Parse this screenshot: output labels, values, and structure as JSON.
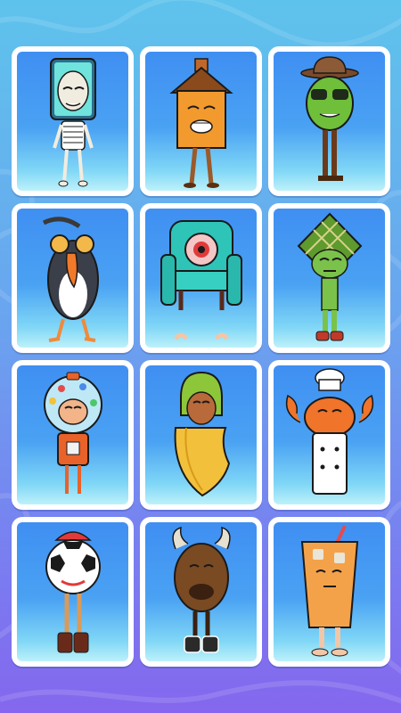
{
  "colors": {
    "background_top": "#5ec3ec",
    "background_bottom": "#8467ee",
    "card_frame": "#ffffff",
    "card_bg_top": "#3f8ff2",
    "card_bg_bottom": "#bdf1fa"
  },
  "characters": [
    {
      "id": "tablet-skeleton",
      "icon": "tablet-skeleton-icon"
    },
    {
      "id": "birdhouse",
      "icon": "birdhouse-icon"
    },
    {
      "id": "cowboy-pickle",
      "icon": "cowboy-pickle-icon"
    },
    {
      "id": "toucan-glasses",
      "icon": "toucan-icon"
    },
    {
      "id": "armchair-eye",
      "icon": "armchair-eye-icon"
    },
    {
      "id": "ketupat-man",
      "icon": "ketupat-icon"
    },
    {
      "id": "gumball-machine",
      "icon": "gumball-machine-icon"
    },
    {
      "id": "banana-monkey",
      "icon": "banana-monkey-icon"
    },
    {
      "id": "crab-chef",
      "icon": "crab-chef-icon"
    },
    {
      "id": "soccer-ball",
      "icon": "soccer-ball-icon"
    },
    {
      "id": "bison-sneakers",
      "icon": "bison-icon"
    },
    {
      "id": "iced-tea-glass",
      "icon": "iced-tea-glass-icon"
    }
  ]
}
